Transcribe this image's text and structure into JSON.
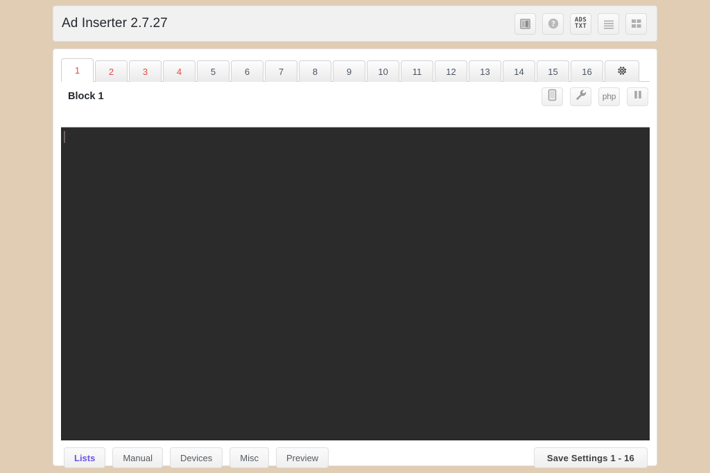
{
  "header": {
    "title": "Ad Inserter 2.7.27",
    "icons": [
      {
        "name": "manual-book-icon",
        "label": "Manual"
      },
      {
        "name": "help-question-icon",
        "label": "Help"
      },
      {
        "name": "ads-txt-icon",
        "line1": "ADS",
        "line2": "TXT"
      },
      {
        "name": "list-lines-icon",
        "label": "List"
      },
      {
        "name": "grid-blocks-icon",
        "label": "Blocks"
      }
    ]
  },
  "tabs": {
    "items": [
      {
        "label": "1",
        "state": "active"
      },
      {
        "label": "2",
        "state": "red"
      },
      {
        "label": "3",
        "state": "red"
      },
      {
        "label": "4",
        "state": "red"
      },
      {
        "label": "5",
        "state": "normal"
      },
      {
        "label": "6",
        "state": "normal"
      },
      {
        "label": "7",
        "state": "normal"
      },
      {
        "label": "8",
        "state": "normal"
      },
      {
        "label": "9",
        "state": "normal"
      },
      {
        "label": "10",
        "state": "normal"
      },
      {
        "label": "11",
        "state": "normal"
      },
      {
        "label": "12",
        "state": "normal"
      },
      {
        "label": "13",
        "state": "normal"
      },
      {
        "label": "14",
        "state": "normal"
      },
      {
        "label": "15",
        "state": "normal"
      },
      {
        "label": "16",
        "state": "normal"
      }
    ],
    "settings_tab": {
      "name": "gear-icon",
      "label": ""
    }
  },
  "block": {
    "title": "Block 1",
    "icons": [
      {
        "name": "device-tablet-icon",
        "label": ""
      },
      {
        "name": "wrench-icon",
        "label": ""
      },
      {
        "name": "php-icon",
        "label": "php"
      },
      {
        "name": "pause-icon",
        "label": ""
      }
    ]
  },
  "editor": {
    "content": "",
    "caret_visible": true
  },
  "footer": {
    "buttons": [
      {
        "label": "Lists",
        "accent": true
      },
      {
        "label": "Manual",
        "accent": false
      },
      {
        "label": "Devices",
        "accent": false
      },
      {
        "label": "Misc",
        "accent": false
      },
      {
        "label": "Preview",
        "accent": false
      }
    ],
    "save_label": "Save Settings 1 - 16"
  },
  "colors": {
    "page_background": "#e0cdb4",
    "header_background": "#f1f1f1",
    "panel_background": "#ffffff",
    "editor_background": "#2b2b2b",
    "tab_active_text": "#e8483c",
    "accent_button_text": "#6c54e8"
  }
}
